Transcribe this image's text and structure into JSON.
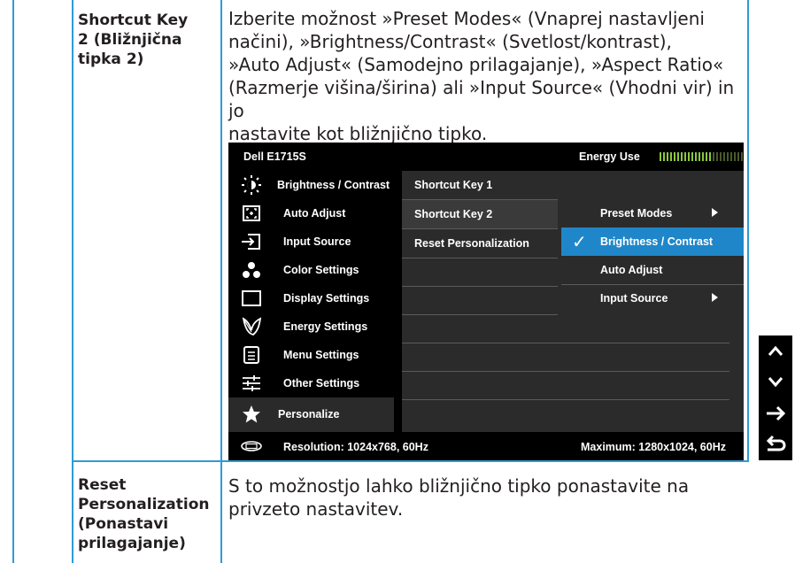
{
  "rows": [
    {
      "label": "Shortcut Key 2 (Bližnjična tipka 2)",
      "label_lines": [
        "Shortcut Key",
        "2 (Bližnjična",
        "tipka 2)"
      ],
      "desc_lines": [
        "Izberite možnost »Preset Modes« (Vnaprej nastavljeni",
        "načini), »Brightness/Contrast« (Svetlost/kontrast),",
        "»Auto Adjust« (Samodejno prilagajanje), »Aspect Ratio«",
        "(Razmerje višina/širina) ali »Input Source« (Vhodni vir) in jo",
        "nastavite kot bližnjično tipko."
      ]
    },
    {
      "label": "Reset Personalization (Ponastavi prilagajanje)",
      "label_lines": [
        "Reset",
        "Personalization",
        "(Ponastavi",
        "prilagajanje)"
      ],
      "desc_lines": [
        "S to možnostjo lahko bližnjično tipko ponastavite na",
        "privzeto nastavitev."
      ]
    }
  ],
  "osd": {
    "model": "Dell E1715S",
    "energy_label": "Energy Use",
    "menu": [
      {
        "label": "Brightness / Contrast",
        "icon": "brightness-icon"
      },
      {
        "label": "Auto Adjust",
        "icon": "auto-adjust-icon"
      },
      {
        "label": "Input Source",
        "icon": "input-source-icon"
      },
      {
        "label": "Color Settings",
        "icon": "color-settings-icon"
      },
      {
        "label": "Display Settings",
        "icon": "display-settings-icon"
      },
      {
        "label": "Energy Settings",
        "icon": "energy-settings-icon"
      },
      {
        "label": "Menu Settings",
        "icon": "menu-settings-icon"
      },
      {
        "label": "Other Settings",
        "icon": "other-settings-icon"
      },
      {
        "label": "Personalize",
        "icon": "star-icon",
        "selected": true
      }
    ],
    "submenu": [
      "Shortcut Key 1",
      "Shortcut Key 2",
      "Reset Personalization"
    ],
    "options": [
      {
        "label": "Preset Modes",
        "arrow": true
      },
      {
        "label": "Brightness / Contrast",
        "checked": true,
        "highlighted": true
      },
      {
        "label": "Auto Adjust"
      },
      {
        "label": "Input Source",
        "arrow": true
      }
    ],
    "resolution": "Resolution: 1024x768, 60Hz",
    "maximum": "Maximum: 1280x1024, 60Hz",
    "check_glyph": "✓"
  },
  "side_buttons": [
    "up-arrow-icon",
    "down-arrow-icon",
    "right-arrow-icon",
    "back-icon"
  ],
  "colors": {
    "grid": "#2e9bd6",
    "highlight": "#1f87c9",
    "energy_on": "#8cc63f",
    "energy_off": "#4a5a2a"
  }
}
